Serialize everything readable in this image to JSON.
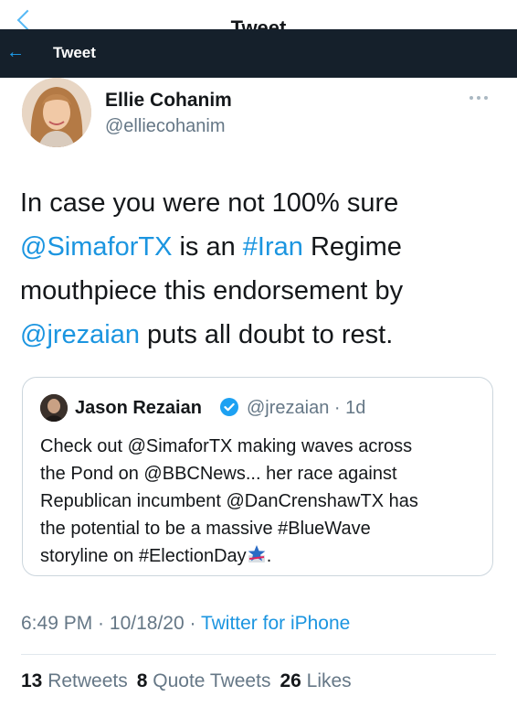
{
  "ghost_header": {
    "title": "Tweet"
  },
  "header": {
    "back_icon": "arrow-left-icon",
    "title": "Tweet"
  },
  "tweet": {
    "author_name": "Ellie Cohanim",
    "author_handle": "@elliecohanim",
    "more_icon": "more-options-icon",
    "text_lines": [
      [
        {
          "t": "In case you were not 100% sure"
        }
      ],
      [
        {
          "t": "@SimaforTX",
          "link": true
        },
        {
          "t": " is an "
        },
        {
          "t": "#Iran",
          "link": true
        },
        {
          "t": " Regime"
        }
      ],
      [
        {
          "t": "mouthpiece this endorsement by"
        }
      ],
      [
        {
          "t": "@jrezaian",
          "link": true
        },
        {
          "t": " puts all doubt to rest."
        }
      ]
    ],
    "time": "6:49 PM",
    "sep1": " · ",
    "date": "10/18/20",
    "sep2": " · ",
    "source": "Twitter for iPhone",
    "stats": [
      {
        "count": "13",
        "label": "Retweets"
      },
      {
        "count": "8",
        "label": "Quote Tweets"
      },
      {
        "count": "26",
        "label": "Likes"
      }
    ]
  },
  "quote": {
    "author_name": "Jason Rezaian",
    "verified_icon": "verified-badge-icon",
    "author_handle": "@jrezaian",
    "sep": " · ",
    "age": "1d",
    "text_lines": [
      [
        {
          "t": "Check out @SimaforTX making waves across"
        }
      ],
      [
        {
          "t": "the Pond on @BBCNews... her race against"
        }
      ],
      [
        {
          "t": "Republican incumbent @DanCrenshawTX has"
        }
      ],
      [
        {
          "t": "the potential to be a massive #BlueWave"
        }
      ],
      [
        {
          "t": "storyline on #ElectionDay"
        },
        {
          "emoji": "ballot-star-icon"
        },
        {
          "t": "."
        }
      ]
    ]
  },
  "colors": {
    "accent": "#1b95e0",
    "header_bg": "#15202b",
    "muted": "#657786"
  }
}
